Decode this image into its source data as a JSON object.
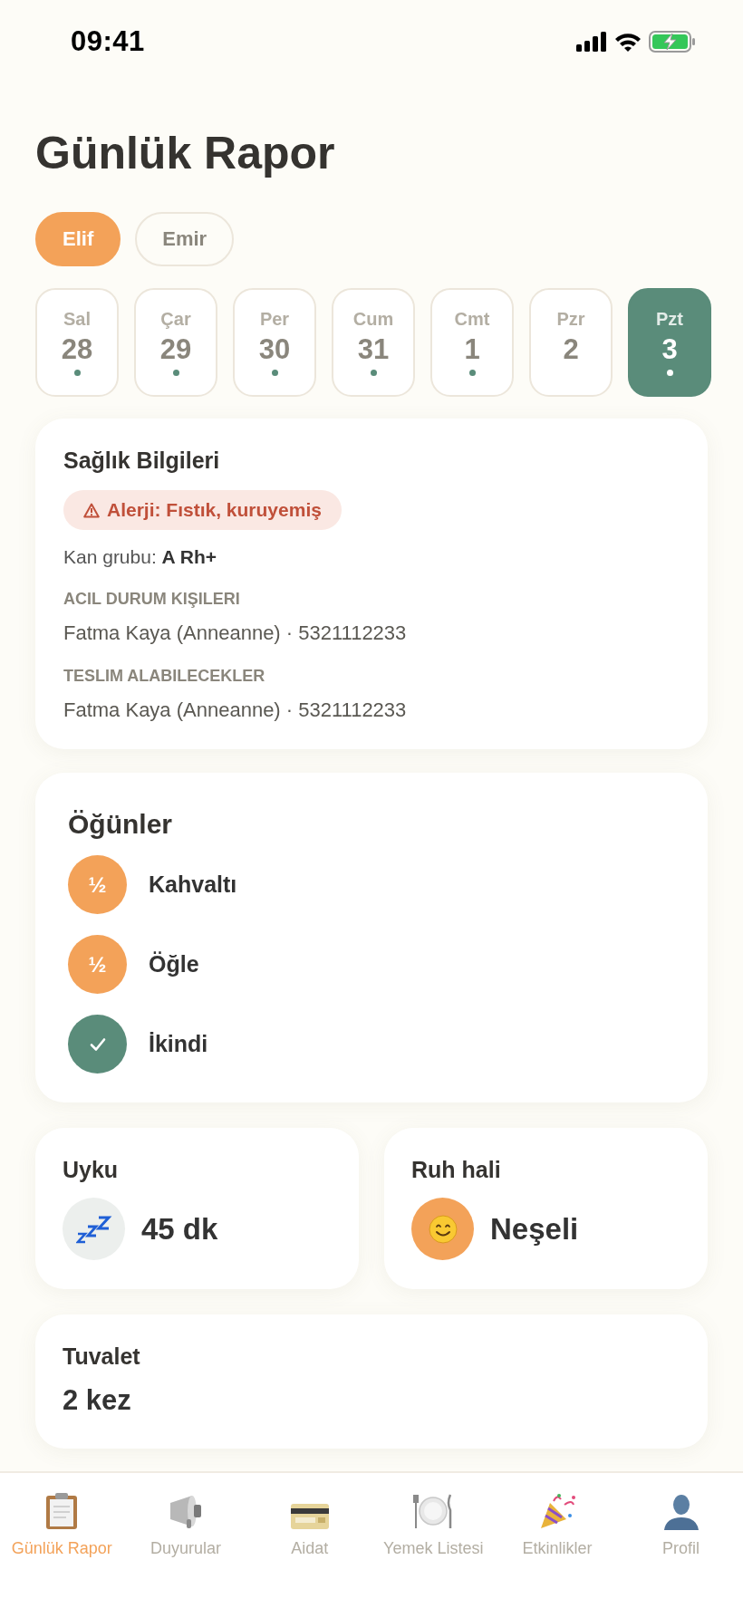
{
  "status_bar": {
    "time": "09:41"
  },
  "title": "Günlük Rapor",
  "children": [
    {
      "name": "Elif",
      "selected": true
    },
    {
      "name": "Emir",
      "selected": false
    }
  ],
  "days": [
    {
      "weekday": "Sal",
      "day": "28",
      "has_report": true,
      "selected": false
    },
    {
      "weekday": "Çar",
      "day": "29",
      "has_report": true,
      "selected": false
    },
    {
      "weekday": "Per",
      "day": "30",
      "has_report": true,
      "selected": false
    },
    {
      "weekday": "Cum",
      "day": "31",
      "has_report": true,
      "selected": false
    },
    {
      "weekday": "Cmt",
      "day": "1",
      "has_report": true,
      "selected": false
    },
    {
      "weekday": "Pzr",
      "day": "2",
      "has_report": false,
      "selected": false
    },
    {
      "weekday": "Pzt",
      "day": "3",
      "has_report": true,
      "selected": true
    }
  ],
  "health": {
    "title": "Sağlık Bilgileri",
    "allergy": "Alerji: Fıstık, kuruyemiş",
    "blood_type": "Kan grubu: **A Rh+**",
    "sections": [
      {
        "heading": "ACIL DURUM KIŞILERI",
        "text": "Fatma Kaya (Anneanne) · 5321112233"
      },
      {
        "heading": "TESLIM ALABILECEKLER",
        "text": "Fatma Kaya (Anneanne) · 5321112233"
      }
    ]
  },
  "meals": {
    "title": "Öğünler",
    "items": [
      {
        "kind": "half",
        "symbol": "½",
        "name": "Kahvaltı"
      },
      {
        "kind": "half",
        "symbol": "½",
        "name": "Öğle"
      },
      {
        "kind": "done",
        "name": "İkindi"
      }
    ]
  },
  "sleep": {
    "title": "Uyku",
    "value": "45 dk"
  },
  "mood": {
    "title": "Ruh hali",
    "value": "Neşeli"
  },
  "toilet": {
    "title": "Tuvalet",
    "value": "2 kez"
  },
  "tabs": [
    {
      "kind": "clipboard",
      "label": "Günlük Rapor",
      "selected": true
    },
    {
      "kind": "megaphone",
      "label": "Duyurular",
      "selected": false
    },
    {
      "kind": "card",
      "label": "Aidat",
      "selected": false
    },
    {
      "kind": "plate",
      "label": "Yemek Listesi",
      "selected": false
    },
    {
      "kind": "party",
      "label": "Etkinlikler",
      "selected": false
    },
    {
      "kind": "person",
      "label": "Profil",
      "selected": false
    }
  ]
}
